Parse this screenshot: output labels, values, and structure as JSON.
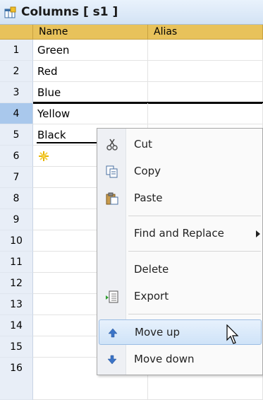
{
  "panel": {
    "title": "Columns [ s1 ]"
  },
  "table": {
    "headers": [
      "Name",
      "Alias"
    ],
    "rows": [
      {
        "num": "1",
        "name": "Green"
      },
      {
        "num": "2",
        "name": "Red"
      },
      {
        "num": "3",
        "name": "Blue"
      },
      {
        "num": "4",
        "name": "Yellow"
      },
      {
        "num": "5",
        "name": "Black"
      },
      {
        "num": "6",
        "name": ""
      },
      {
        "num": "7",
        "name": ""
      },
      {
        "num": "8",
        "name": ""
      },
      {
        "num": "9",
        "name": ""
      },
      {
        "num": "10",
        "name": ""
      },
      {
        "num": "11",
        "name": ""
      },
      {
        "num": "12",
        "name": ""
      },
      {
        "num": "13",
        "name": ""
      },
      {
        "num": "14",
        "name": ""
      },
      {
        "num": "15",
        "name": ""
      },
      {
        "num": "16",
        "name": ""
      }
    ]
  },
  "context_menu": {
    "cut": "Cut",
    "copy": "Copy",
    "paste": "Paste",
    "find_replace": "Find and Replace",
    "delete": "Delete",
    "export": "Export",
    "move_up": "Move up",
    "move_down": "Move down"
  }
}
